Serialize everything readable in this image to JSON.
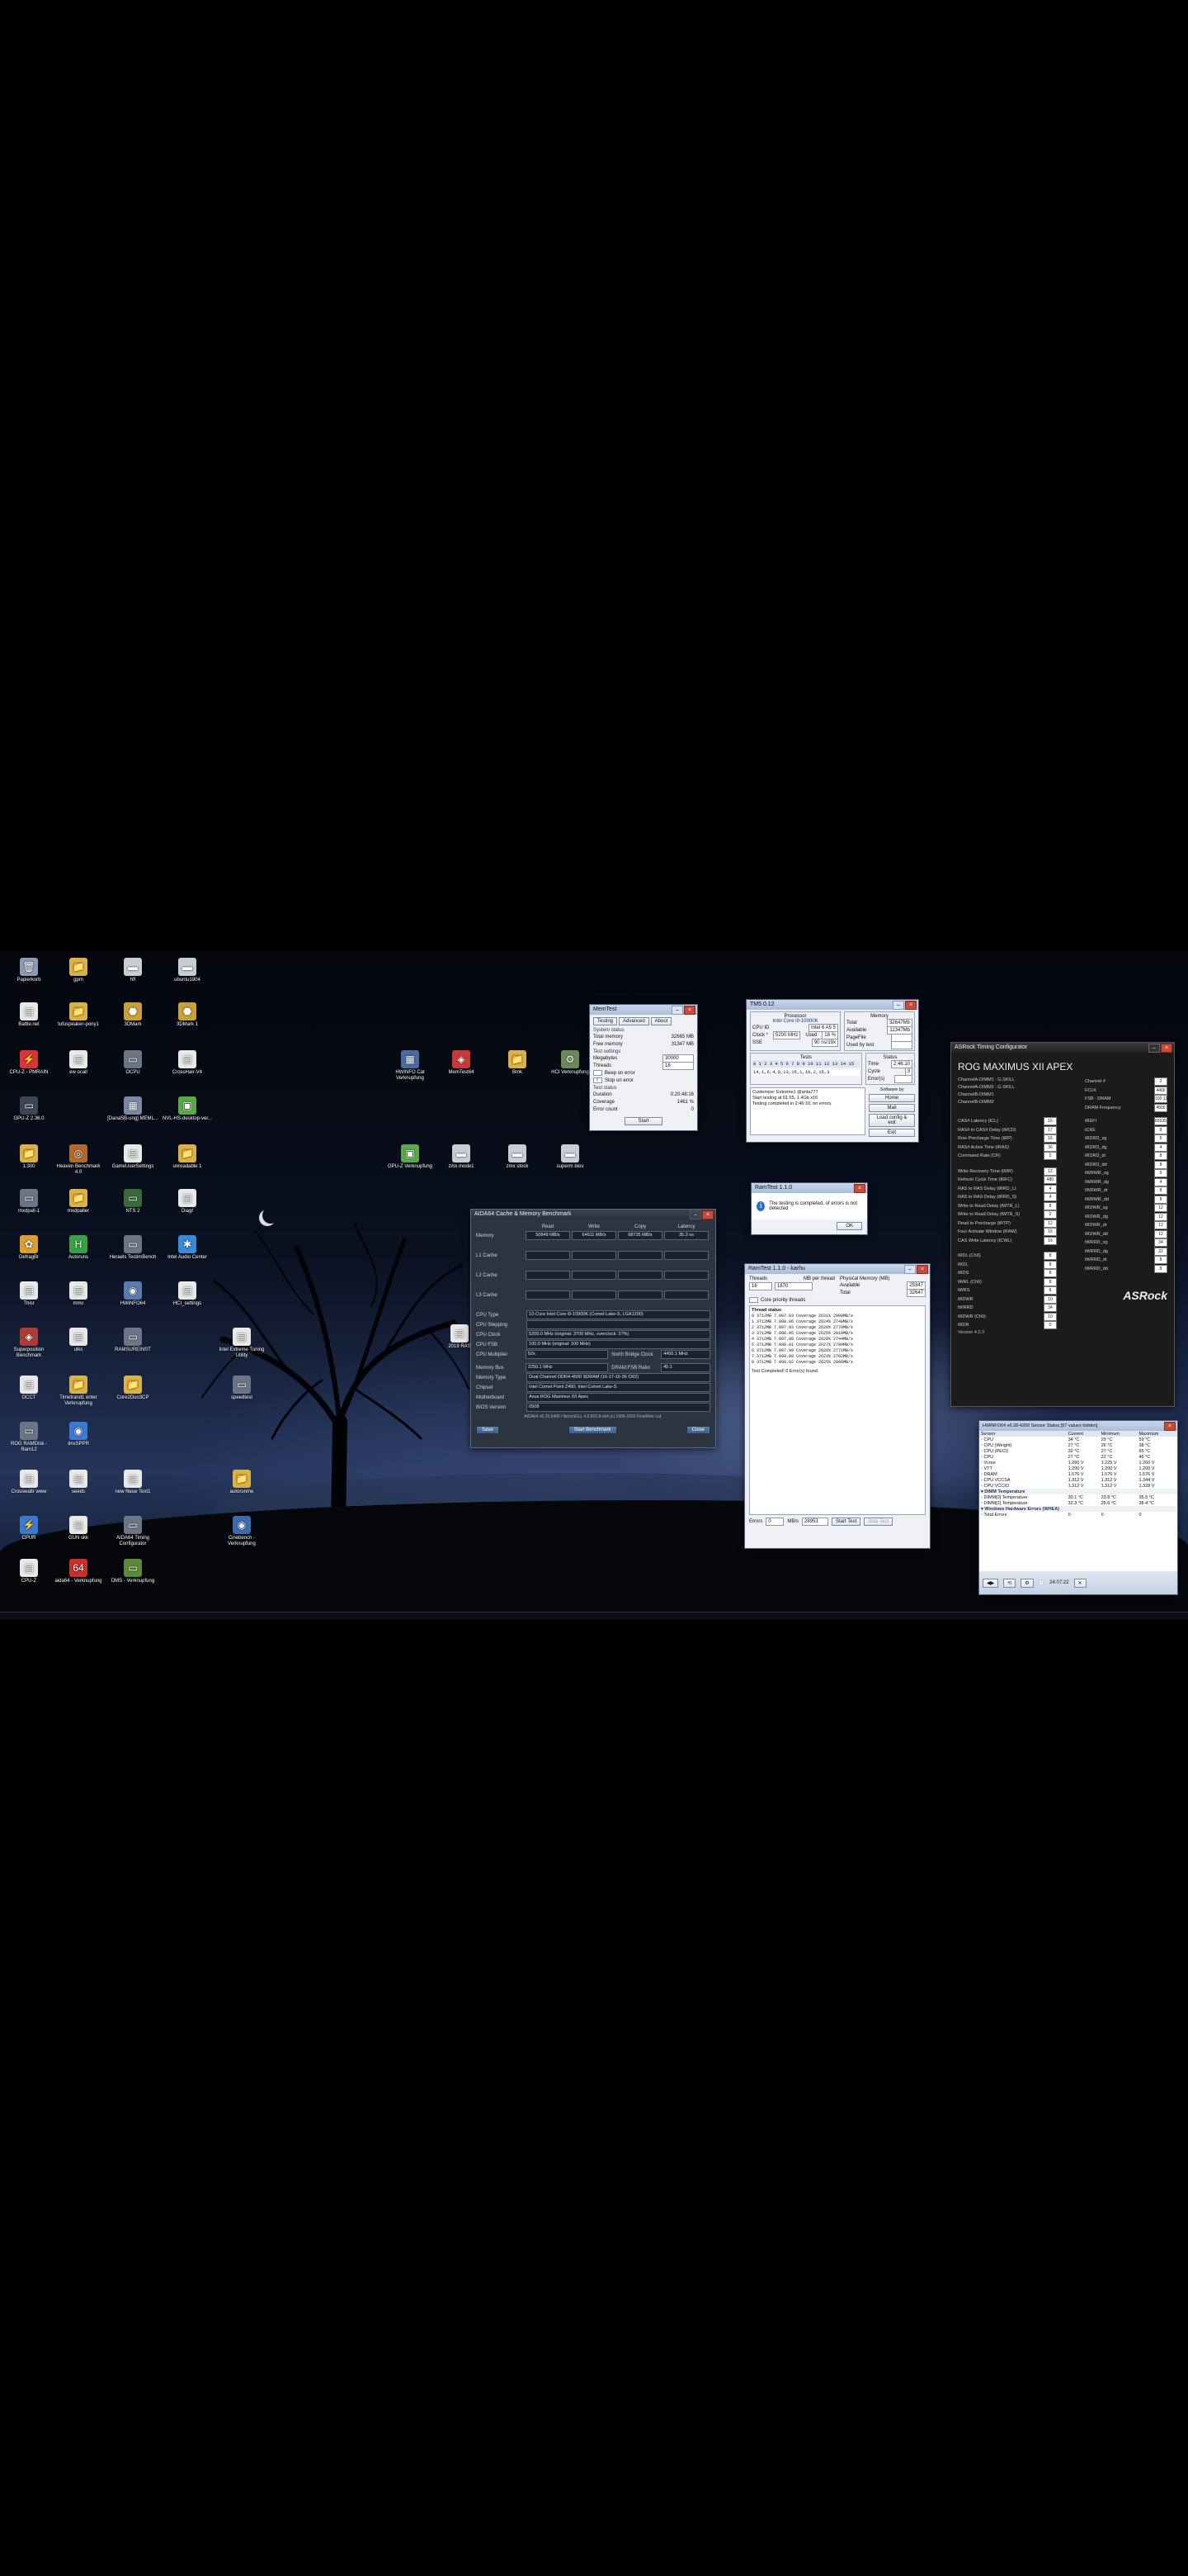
{
  "desktop": {
    "icons": [
      {
        "label": "Papierkorb",
        "glyph": "🗑",
        "color": "#8a9bb5"
      },
      {
        "label": "gpm",
        "glyph": "📁",
        "color": "#d9b24a"
      },
      {
        "label": "hfl",
        "glyph": "▬",
        "color": "#c8ccd4"
      },
      {
        "label": "ubuntu1804",
        "glyph": "▬",
        "color": "#c8ccd4"
      },
      {
        "label": "Battle.net",
        "glyph": "▤",
        "color": "#e8e8e8"
      },
      {
        "label": "tofuspeaker-pony1",
        "glyph": "📁",
        "color": "#d9b24a"
      },
      {
        "label": "3DMark",
        "glyph": "⬣",
        "color": "#c9a13a"
      },
      {
        "label": "3DMark 1",
        "glyph": "⬣",
        "color": "#c9a13a"
      },
      {
        "label": "CPU-Z - PMRAIN",
        "glyph": "⚡",
        "color": "#d8353a"
      },
      {
        "label": "ew ocall",
        "glyph": "▤",
        "color": "#e8e8e8"
      },
      {
        "label": "OCPU",
        "glyph": "▭",
        "color": "#6a7586"
      },
      {
        "label": "CrossHair-V4",
        "glyph": "▤",
        "color": "#e8e8e8"
      },
      {
        "label": "GPU-Z 2.36.0",
        "glyph": "▭",
        "color": "#3c4656"
      },
      {
        "label": "[DanaSB-ung] MEML...",
        "glyph": "▦",
        "color": "#7a8aa5"
      },
      {
        "label": "NVL-HS-desktop-ver...",
        "glyph": "▣",
        "color": "#5aa84a"
      },
      {
        "label": "1.300",
        "glyph": "📁",
        "color": "#d9b24a"
      },
      {
        "label": "Heaven Benchmark 4.0",
        "glyph": "◎",
        "color": "#b06a2a"
      },
      {
        "label": "GameUserSettings",
        "glyph": "▤",
        "color": "#e8e8e8"
      },
      {
        "label": "unreadable 1",
        "glyph": "📁",
        "color": "#d9b24a"
      },
      {
        "label": "mxdpall-1",
        "glyph": "▭",
        "color": "#6a7586"
      },
      {
        "label": "mxdpaller",
        "glyph": "📁",
        "color": "#d9b24a"
      },
      {
        "label": "NTS 2",
        "glyph": "▭",
        "color": "#3a6a3a"
      },
      {
        "label": "Diagt",
        "glyph": "▤",
        "color": "#e8e8e8"
      },
      {
        "label": "DefragBr",
        "glyph": "✿",
        "color": "#d8a030"
      },
      {
        "label": "Autoruns",
        "glyph": "H",
        "color": "#3aa048"
      },
      {
        "label": "Heraels TestimBench",
        "glyph": "▭",
        "color": "#6a7586"
      },
      {
        "label": "Intel Audio Center",
        "glyph": "✱",
        "color": "#3a8ad8"
      },
      {
        "label": "Thisr",
        "glyph": "▤",
        "color": "#e8e8e8"
      },
      {
        "label": "mmc",
        "glyph": "▤",
        "color": "#e8e8e8"
      },
      {
        "label": "HWiNFO64",
        "glyph": "◉",
        "color": "#5a7ab0"
      },
      {
        "label": "HCI_settings",
        "glyph": "▤",
        "color": "#e8e8e8"
      },
      {
        "label": "Superposition Benchmark",
        "glyph": "◈",
        "color": "#b03a3a"
      },
      {
        "label": "ulks",
        "glyph": "▤",
        "color": "#e8e8e8"
      },
      {
        "label": "RAMSUREINST",
        "glyph": "▭",
        "color": "#6a7586"
      },
      {
        "label": "Intel Extreme Tuning Utility",
        "glyph": "▤",
        "color": "#e8e8e8"
      },
      {
        "label": "OCCT",
        "glyph": "▤",
        "color": "#e8e8e8"
      },
      {
        "label": "Timetrand1 enter Verknupfung",
        "glyph": "📁",
        "color": "#d9b24a"
      },
      {
        "label": "Core2Duo3CP",
        "glyph": "📁",
        "color": "#d9b24a"
      },
      {
        "label": "speedtest",
        "glyph": "▭",
        "color": "#6a7586"
      },
      {
        "label": "ROG RAMDisk - Ram12",
        "glyph": "▭",
        "color": "#6a7586"
      },
      {
        "label": "dnsSPPR",
        "glyph": "◉",
        "color": "#3a7ad0"
      },
      {
        "label": "Crosswaltr www",
        "glyph": "▤",
        "color": "#e8e8e8"
      },
      {
        "label": "seeds",
        "glyph": "▤",
        "color": "#e8e8e8"
      },
      {
        "label": "new Neue Text1",
        "glyph": "▤",
        "color": "#e8e8e8"
      },
      {
        "label": "autorunme",
        "glyph": "📁",
        "color": "#d9b24a"
      },
      {
        "label": "CPUR",
        "glyph": "⚡",
        "color": "#3a7ad0"
      },
      {
        "label": "GUN skk",
        "glyph": "▤",
        "color": "#e8e8e8"
      },
      {
        "label": "AIDA64 Timing Configurator",
        "glyph": "▭",
        "color": "#6a7586"
      },
      {
        "label": "Cinebench - Verknupfung",
        "glyph": "◉",
        "color": "#3a6ab0"
      },
      {
        "label": "CPU-Z",
        "glyph": "▤",
        "color": "#e8e8e8"
      },
      {
        "label": "aida64 - Verknupfung",
        "glyph": "64",
        "color": "#c8302a"
      },
      {
        "label": "DMS - Verknupfung",
        "glyph": "▭",
        "color": "#5a8a3a"
      },
      {
        "label": "HWINFO Cat Verknupfung",
        "glyph": "▦",
        "color": "#4a6aa0"
      },
      {
        "label": "MemTest64",
        "glyph": "◈",
        "color": "#c83a3a"
      },
      {
        "label": "Bmk",
        "glyph": "📁",
        "color": "#d9b24a"
      },
      {
        "label": "HCI Verknupfung",
        "glyph": "⚙",
        "color": "#6a8a5a"
      },
      {
        "label": "GPU-Z Verknupfung",
        "glyph": "▣",
        "color": "#5aa84a"
      },
      {
        "label": "zmx mode1",
        "glyph": "▬",
        "color": "#c8ccd4"
      },
      {
        "label": "zmx stock",
        "glyph": "▬",
        "color": "#c8ccd4"
      },
      {
        "label": "superm bios",
        "glyph": "▬",
        "color": "#c8ccd4"
      },
      {
        "label": "2019 RAS",
        "glyph": "▤",
        "color": "#e8e8e8"
      }
    ]
  },
  "memtest": {
    "title": "MemTest",
    "tabs": [
      "Testing",
      "Advanced",
      "About"
    ],
    "system_status_label": "System status",
    "total_memory_label": "Total memory",
    "total_memory": "32665 MB",
    "free_memory_label": "Free memory",
    "free_memory": "31347 MB",
    "test_settings_label": "Test settings",
    "megabytes_label": "Megabytes",
    "megabytes": "30000",
    "threads_label": "Threads",
    "threads": "16",
    "beep_label": "Beep on error",
    "stop_label": "Stop on error",
    "test_status_label": "Test status",
    "duration_label": "Duration",
    "duration": "0:20:48:16",
    "coverage_label": "Coverage",
    "coverage": "1461 %",
    "errors_label": "Error count",
    "errors": "0",
    "start_label": "Start"
  },
  "tm5": {
    "title": "TM5 0.12",
    "processor_label": "Processor",
    "processor": "Intel Core i9-10900K",
    "memory_label": "Memory",
    "cpu_id_label": "CPU ID",
    "cpu_id": "Intel 6 A5 5",
    "clock_label": "Clock *",
    "clock": "5200 MHz",
    "used_label": "Used",
    "used": "18 %",
    "sse_label": "SSE",
    "sse": "90 ns/19x",
    "total_label": "Total",
    "total": "32647Mb",
    "available_label": "Available",
    "available": "11347Mb",
    "pagefile_label": "PageFile",
    "usedbytest_label": "Used by test",
    "tests_label": "Tests",
    "tests_digits": "0 1 2 3 4 5 6 7 8 9 10 11 12 13 14 15",
    "tests_sequence": "14,1,6,4,8,13,15,1,10,2,15,3",
    "status_label": "Status",
    "time_label": "Time",
    "time": "2:46:10",
    "cycle_label": "Cycle",
    "cycle": "3",
    "errors_label": "Error(s)",
    "errors": "",
    "log": [
      "Customize: Extreme1 @anta777",
      "Start testing at 01:55, 1.4Gb x16",
      "Testing completed in 2:46:10, no errors."
    ],
    "buttons": [
      "Home",
      "Mail",
      "Load config & exit",
      "Exit"
    ],
    "soft_label": "Software by"
  },
  "completion_dialog": {
    "title": "RamTest 1.1.0",
    "message": "The testing is completed, of errors is not detected",
    "ok_label": "OK"
  },
  "aida": {
    "title": "AIDA64 Cache & Memory Benchmark",
    "col_headers": [
      "Read",
      "Write",
      "Copy",
      "Latency"
    ],
    "rows": [
      {
        "label": "Memory",
        "values": [
          "50849 MB/s",
          "64611 MB/s",
          "68735 MB/s",
          "35.3 ns"
        ]
      },
      {
        "label": "L1 Cache",
        "values": [
          "",
          "",
          "",
          ""
        ]
      },
      {
        "label": "L2 Cache",
        "values": [
          "",
          "",
          "",
          ""
        ]
      },
      {
        "label": "L3 Cache",
        "values": [
          "",
          "",
          "",
          ""
        ]
      }
    ],
    "info": [
      {
        "label": "CPU Type",
        "value": "10-Core Intel Core i9-10900K (Comet Lake-S, LGA1200)"
      },
      {
        "label": "CPU Stepping",
        "value": ""
      },
      {
        "label": "CPU Clock",
        "value": "5200.0 MHz (original: 3700 MHz, overclock: 27%)"
      },
      {
        "label": "CPU FSB",
        "value": "100.0 MHz (original: 100 MHz)"
      },
      {
        "label": "CPU Multiplier",
        "value": "52x"
      },
      {
        "label": "Memory Bus",
        "value": "2250.1 MHz"
      },
      {
        "label": "Memory Type",
        "value": "Dual Channel DDR4-4500 SDRAM (16-17-16-36 CR2)"
      },
      {
        "label": "Chipset",
        "value": "Intel Comet Point Z490, Intel Comet Lake-S"
      },
      {
        "label": "Motherboard",
        "value": "Asus ROG Maximus XII Apex"
      },
      {
        "label": "BIOS Version",
        "value": "0508"
      }
    ],
    "north_bridge_label": "North Bridge Clock",
    "north_bridge": "4400.1 MHz",
    "dram_fsb_label": "DRAM:FSB Ratio",
    "dram_fsb": "45:1",
    "footer": "AIDA64 v6.25.5400 / BenchDLL 4.5.816.8-x64  (c) 1995-2020 FinalWire Ltd.",
    "buttons": {
      "save": "Save",
      "start": "Start Benchmark",
      "close": "Close"
    }
  },
  "ramtest": {
    "title": "RamTest 1.1.0 - karhu",
    "threads_label": "Threads",
    "threads": "16",
    "mb_label": "MB per thread",
    "mb": "1870",
    "physical_label": "Physical Memory (MB)",
    "available_label": "Available",
    "available": "25347",
    "total_label": "Total",
    "total": "32647",
    "cpu_cache_label": "Core priority threads",
    "log_header": "Thread status",
    "log": [
      "0  3712MB  7.097.93  Coverage  2631%  2900MB/s",
      "1  3712MB  7.098.06  Coverage  2624%  2748MB/s",
      "2  3712MB  7.097.93  Coverage  2628%  2770MB/s",
      "3  3712MB  7.098.05  Coverage  2625%  2810MB/s",
      "4  3712MB  7.097.88  Coverage  2629%  2744MB/s",
      "5  3712MB  7.098.01  Coverage  2627%  2799MB/s",
      "6  3712MB  7.097.99  Coverage  2626%  2771MB/s",
      "7  3712MB  7.098.09  Coverage  2623%  2782MB/s",
      "8  3712MB  7.098.02  Coverage  2625%  2806MB/s"
    ],
    "done_label": "Test Completed! 0 Error(s) found.",
    "errors_label": "Errors",
    "errors": "0",
    "mbs_label": "MB/s",
    "mbs": "28953",
    "start_label": "Start Test",
    "stop_label": "Stop Test"
  },
  "asrock": {
    "title": "ASRock Timing Configurator",
    "board": "ROG MAXIMUS XII APEX",
    "channels": [
      "ChannelA-DIMM1 : G.SKILL",
      "ChannelA-DIMM2 : G.SKILL",
      "ChannelB-DIMM1",
      "ChannelB-DIMM2"
    ],
    "top_right": [
      {
        "label": "Channel #",
        "value": "2"
      },
      {
        "label": "FCLK",
        "value": "4400"
      },
      {
        "label": "FSB : DRAM",
        "value": "100:133"
      },
      {
        "label": "DRAM Frequency",
        "value": "4500"
      }
    ],
    "left": [
      {
        "label": "CAS# Latency (tCL)",
        "value": "16"
      },
      {
        "label": "RAS# to CAS# Delay (tRCD)",
        "value": "17"
      },
      {
        "label": "Row Precharge Time (tRP)",
        "value": "16"
      },
      {
        "label": "RAS# Active Time (tRAS)",
        "value": "36"
      },
      {
        "label": "Command Rate (CR)",
        "value": "2"
      },
      {
        "label": "",
        "value": ""
      },
      {
        "label": "Write Recovery Time (tWR)",
        "value": "12"
      },
      {
        "label": "Refresh Cycle Time (tRFC)",
        "value": "480"
      },
      {
        "label": "RAS to RAS Delay (tRRD_L)",
        "value": "4"
      },
      {
        "label": "RAS to RAS Delay (tRRD_S)",
        "value": "4"
      },
      {
        "label": "Write to Read Delay (tWTR_L)",
        "value": "8"
      },
      {
        "label": "Write to Read Delay (tWTR_S)",
        "value": "2"
      },
      {
        "label": "Read to Precharge (tRTP)",
        "value": "12"
      },
      {
        "label": "Four Activate Window (tFAW)",
        "value": "16"
      },
      {
        "label": "CAS Write Latency (tCWL)",
        "value": "16"
      }
    ],
    "left2": [
      {
        "label": "tRDL (Ch0)",
        "value": "8"
      },
      {
        "label": "tRDL",
        "value": "8"
      },
      {
        "label": "tRDS",
        "value": "8"
      },
      {
        "label": "tWRL (Ch0)",
        "value": "8"
      },
      {
        "label": "tWRS",
        "value": "8"
      },
      {
        "label": "tRDWR",
        "value": "10"
      },
      {
        "label": "tWRRD",
        "value": "34"
      },
      {
        "label": "tRDWR (Ch0)",
        "value": "10"
      },
      {
        "label": "tRDR",
        "value": "0"
      }
    ],
    "right": [
      "tREFI",
      "tCKE",
      "tRDRD_sg",
      "tRDRD_dg",
      "tRDRD_dr",
      "tRDRD_dd",
      "tWRWR_sg",
      "tWRWR_dg",
      "tWRWR_dr",
      "tWRWR_dd",
      "tRDWR_sg",
      "tRDWR_dg",
      "tRDWR_dr",
      "tRDWR_dd",
      "tWRRD_sg",
      "tWRRD_dg",
      "tWRRD_dr",
      "tWRRD_dd"
    ],
    "right_vals": [
      "65535",
      "8",
      "5",
      "4",
      "8",
      "8",
      "5",
      "4",
      "8",
      "8",
      "12",
      "12",
      "12",
      "12",
      "34",
      "22",
      "8",
      "8"
    ],
    "logo": "ASRock",
    "version": "Version 4.0.3"
  },
  "hwinfo": {
    "title": "HWiNFO64 v6.28-4200 Sensor Status [97 values hidden]",
    "headers": [
      "Sensor",
      "Current",
      "Minimum",
      "Maximum"
    ],
    "rows": [
      [
        "CPU",
        "34 °C",
        "29 °C",
        "59 °C"
      ],
      [
        "CPU (Weight)",
        "27 °C",
        "26 °C",
        "38 °C"
      ],
      [
        "CPU (PECI)",
        "32 °C",
        "27 °C",
        "65 °C"
      ],
      [
        "CPU",
        "27 °C",
        "22 °C",
        "46 °C"
      ],
      [
        "Vcore",
        "1.260 V",
        "1.225 V",
        "1.260 V"
      ],
      [
        "VTT",
        "1.200 V",
        "1.200 V",
        "1.200 V"
      ],
      [
        "DRAM",
        "1.576 V",
        "1.576 V",
        "1.576 V"
      ],
      [
        "CPU VCCSA",
        "1.312 V",
        "1.312 V",
        "1.344 V"
      ],
      [
        "CPU VCCIO",
        "1.312 V",
        "1.312 V",
        "1.328 V"
      ]
    ],
    "group2": "DIMM Temperature",
    "rows2": [
      [
        "DIMM[0] Temperature",
        "30.1 °C",
        "23.8 °C",
        "35.9 °C"
      ],
      [
        "DIMM[2] Temperature",
        "32.3 °C",
        "25.6 °C",
        "38.4 °C"
      ]
    ],
    "group3": "Windows Hardware Errors (WHEA)",
    "rows3": [
      [
        "Total Errors",
        "0",
        "0",
        "0"
      ]
    ],
    "clock": "24:07:22"
  }
}
